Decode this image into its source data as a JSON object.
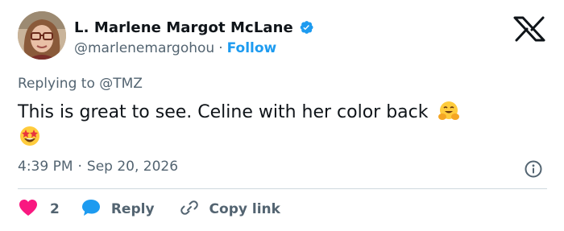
{
  "author": {
    "display_name": "L. Marlene Margot McLane",
    "handle": "@marlenemargohou",
    "separator": "·",
    "follow_label": "Follow",
    "verified_color": "#1d9bf0"
  },
  "reply_context": {
    "prefix": "Replying to ",
    "mention": "@TMZ"
  },
  "tweet": {
    "text": "This is great to see. Celine with her color back",
    "emojis": [
      "hugging-face-emoji",
      "star-struck-emoji"
    ]
  },
  "meta": {
    "time": "4:39 PM",
    "separator": "·",
    "date": "Sep 20, 2026"
  },
  "actions": {
    "like_count": "2",
    "reply_label": "Reply",
    "copy_link_label": "Copy link"
  },
  "colors": {
    "accent": "#1d9bf0",
    "like": "#f91880",
    "text": "#0f1419",
    "secondary": "#536471",
    "divider": "#cfd9de"
  },
  "icons": [
    "verified-badge-icon",
    "x-logo-icon",
    "info-icon",
    "heart-icon",
    "reply-bubble-icon",
    "link-icon"
  ]
}
